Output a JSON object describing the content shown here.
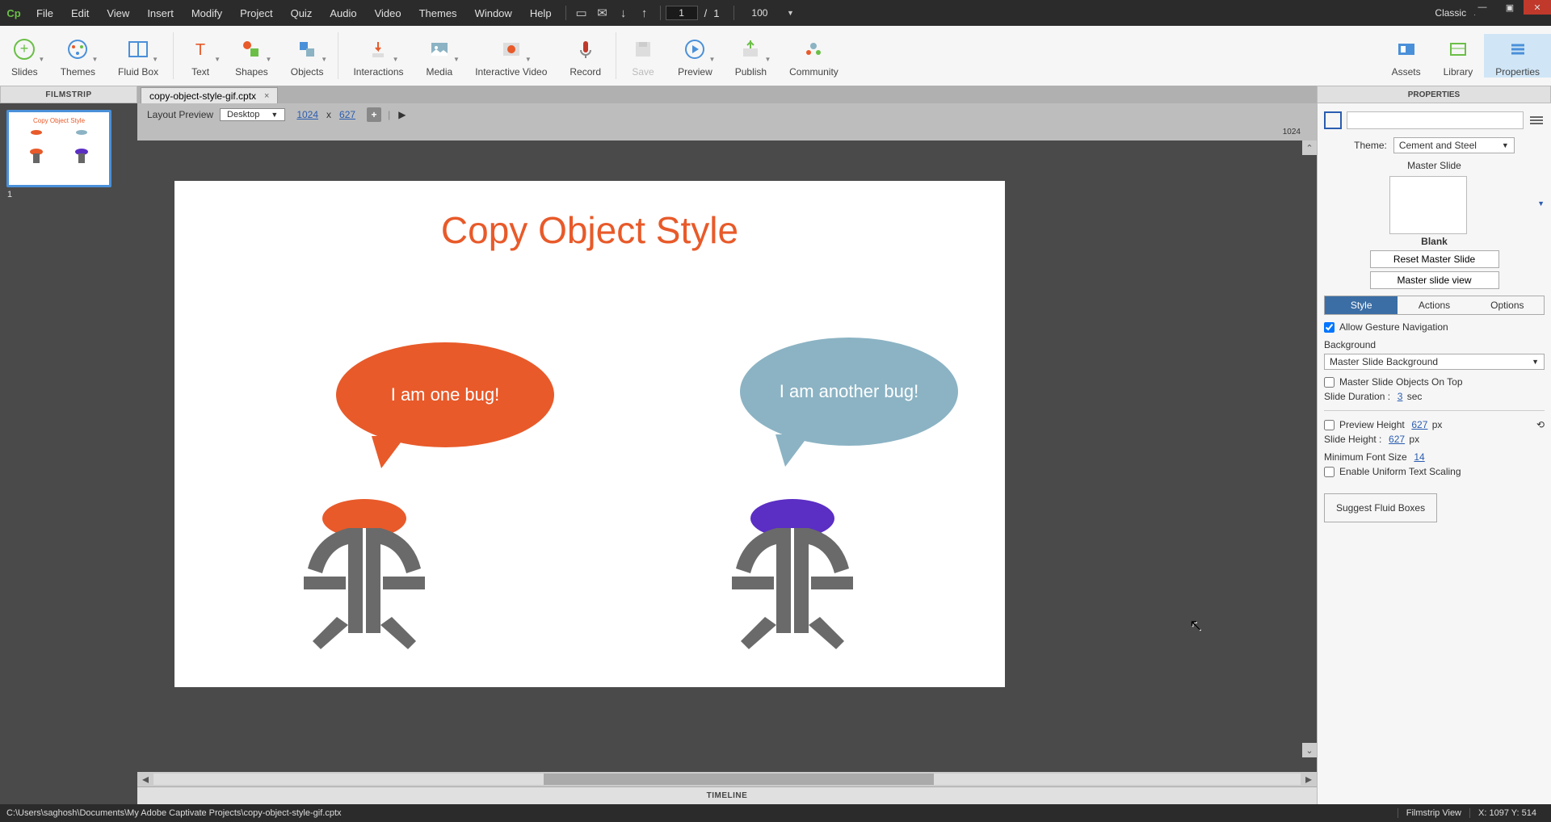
{
  "menu": {
    "items": [
      "File",
      "Edit",
      "View",
      "Insert",
      "Modify",
      "Project",
      "Quiz",
      "Audio",
      "Video",
      "Themes",
      "Window",
      "Help"
    ],
    "page_current": "1",
    "page_total": "1",
    "zoom": "100",
    "workspace": "Classic"
  },
  "ribbon": {
    "items": [
      "Slides",
      "Themes",
      "Fluid Box",
      "Text",
      "Shapes",
      "Objects",
      "Interactions",
      "Media",
      "Interactive Video",
      "Record",
      "Save",
      "Preview",
      "Publish",
      "Community"
    ],
    "right": [
      "Assets",
      "Library",
      "Properties"
    ]
  },
  "headers": {
    "filmstrip": "FILMSTRIP",
    "properties": "PROPERTIES"
  },
  "tab": {
    "name": "copy-object-style-gif.cptx"
  },
  "layoutbar": {
    "label": "Layout Preview",
    "device": "Desktop",
    "w": "1024",
    "h": "627",
    "ruler_end": "1024"
  },
  "filmstrip": {
    "index": "1"
  },
  "slide": {
    "title": "Copy Object Style",
    "bubble1": "I am one bug!",
    "bubble2": "I am another bug!"
  },
  "props": {
    "theme_label": "Theme:",
    "theme_value": "Cement and Steel",
    "master_section": "Master Slide",
    "master_name": "Blank",
    "btn_reset": "Reset Master Slide",
    "btn_view": "Master slide view",
    "tabs": [
      "Style",
      "Actions",
      "Options"
    ],
    "allow_gesture": "Allow Gesture Navigation",
    "background_label": "Background",
    "background_value": "Master Slide Background",
    "master_top": "Master Slide Objects On Top",
    "duration_label": "Slide Duration :",
    "duration_value": "3",
    "duration_unit": "sec",
    "preview_h_label": "Preview Height",
    "preview_h_value": "627",
    "px": "px",
    "slide_h_label": "Slide Height :",
    "slide_h_value": "627",
    "min_font_label": "Minimum Font Size",
    "min_font_value": "14",
    "uniform": "Enable Uniform Text Scaling",
    "suggest": "Suggest Fluid Boxes"
  },
  "timeline": "TIMELINE",
  "status": {
    "path": "C:\\Users\\saghosh\\Documents\\My Adobe Captivate Projects\\copy-object-style-gif.cptx",
    "view": "Filmstrip View",
    "coords": "X: 1097 Y: 514"
  }
}
